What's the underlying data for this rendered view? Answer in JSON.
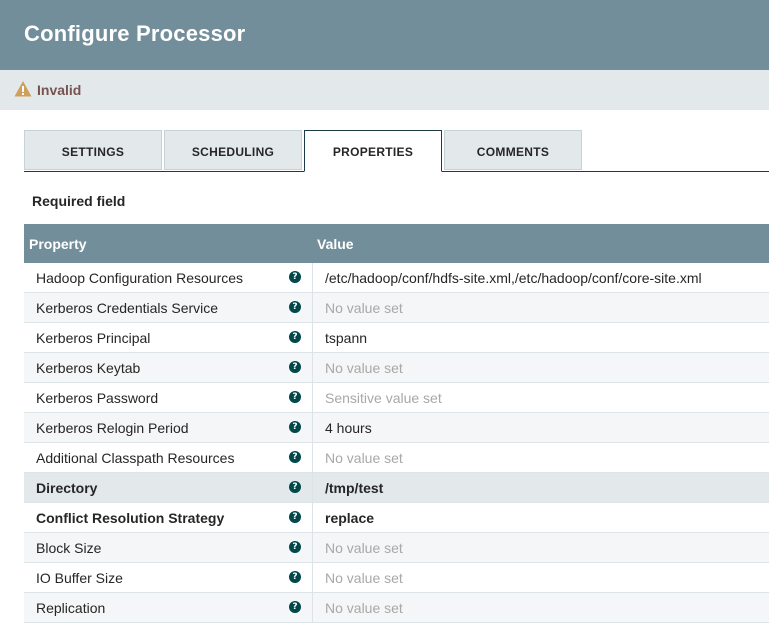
{
  "dialog": {
    "title": "Configure Processor",
    "status": "Invalid",
    "status_icon": "warning-triangle-icon",
    "warning_color": "#cf9f5d"
  },
  "tabs": [
    {
      "label": "SETTINGS",
      "active": false
    },
    {
      "label": "SCHEDULING",
      "active": false
    },
    {
      "label": "PROPERTIES",
      "active": true
    },
    {
      "label": "COMMENTS",
      "active": false
    }
  ],
  "properties": {
    "required_label": "Required field",
    "columns": {
      "property": "Property",
      "value": "Value"
    },
    "rows": [
      {
        "name": "Hadoop Configuration Resources",
        "value": "/etc/hadoop/conf/hdfs-site.xml,/etc/hadoop/conf/core-site.xml",
        "placeholder": false,
        "required": false
      },
      {
        "name": "Kerberos Credentials Service",
        "value": "No value set",
        "placeholder": true,
        "required": false
      },
      {
        "name": "Kerberos Principal",
        "value": "tspann",
        "placeholder": false,
        "required": false
      },
      {
        "name": "Kerberos Keytab",
        "value": "No value set",
        "placeholder": true,
        "required": false
      },
      {
        "name": "Kerberos Password",
        "value": "Sensitive value set",
        "placeholder": true,
        "required": false
      },
      {
        "name": "Kerberos Relogin Period",
        "value": "4 hours",
        "placeholder": false,
        "required": false
      },
      {
        "name": "Additional Classpath Resources",
        "value": "No value set",
        "placeholder": true,
        "required": false
      },
      {
        "name": "Directory",
        "value": "/tmp/test",
        "placeholder": false,
        "required": true
      },
      {
        "name": "Conflict Resolution Strategy",
        "value": "replace",
        "placeholder": false,
        "required": true
      },
      {
        "name": "Block Size",
        "value": "No value set",
        "placeholder": true,
        "required": false
      },
      {
        "name": "IO Buffer Size",
        "value": "No value set",
        "placeholder": true,
        "required": false
      },
      {
        "name": "Replication",
        "value": "No value set",
        "placeholder": true,
        "required": false
      }
    ],
    "help_icon": "question-circle-icon",
    "help_glyph": "?"
  }
}
